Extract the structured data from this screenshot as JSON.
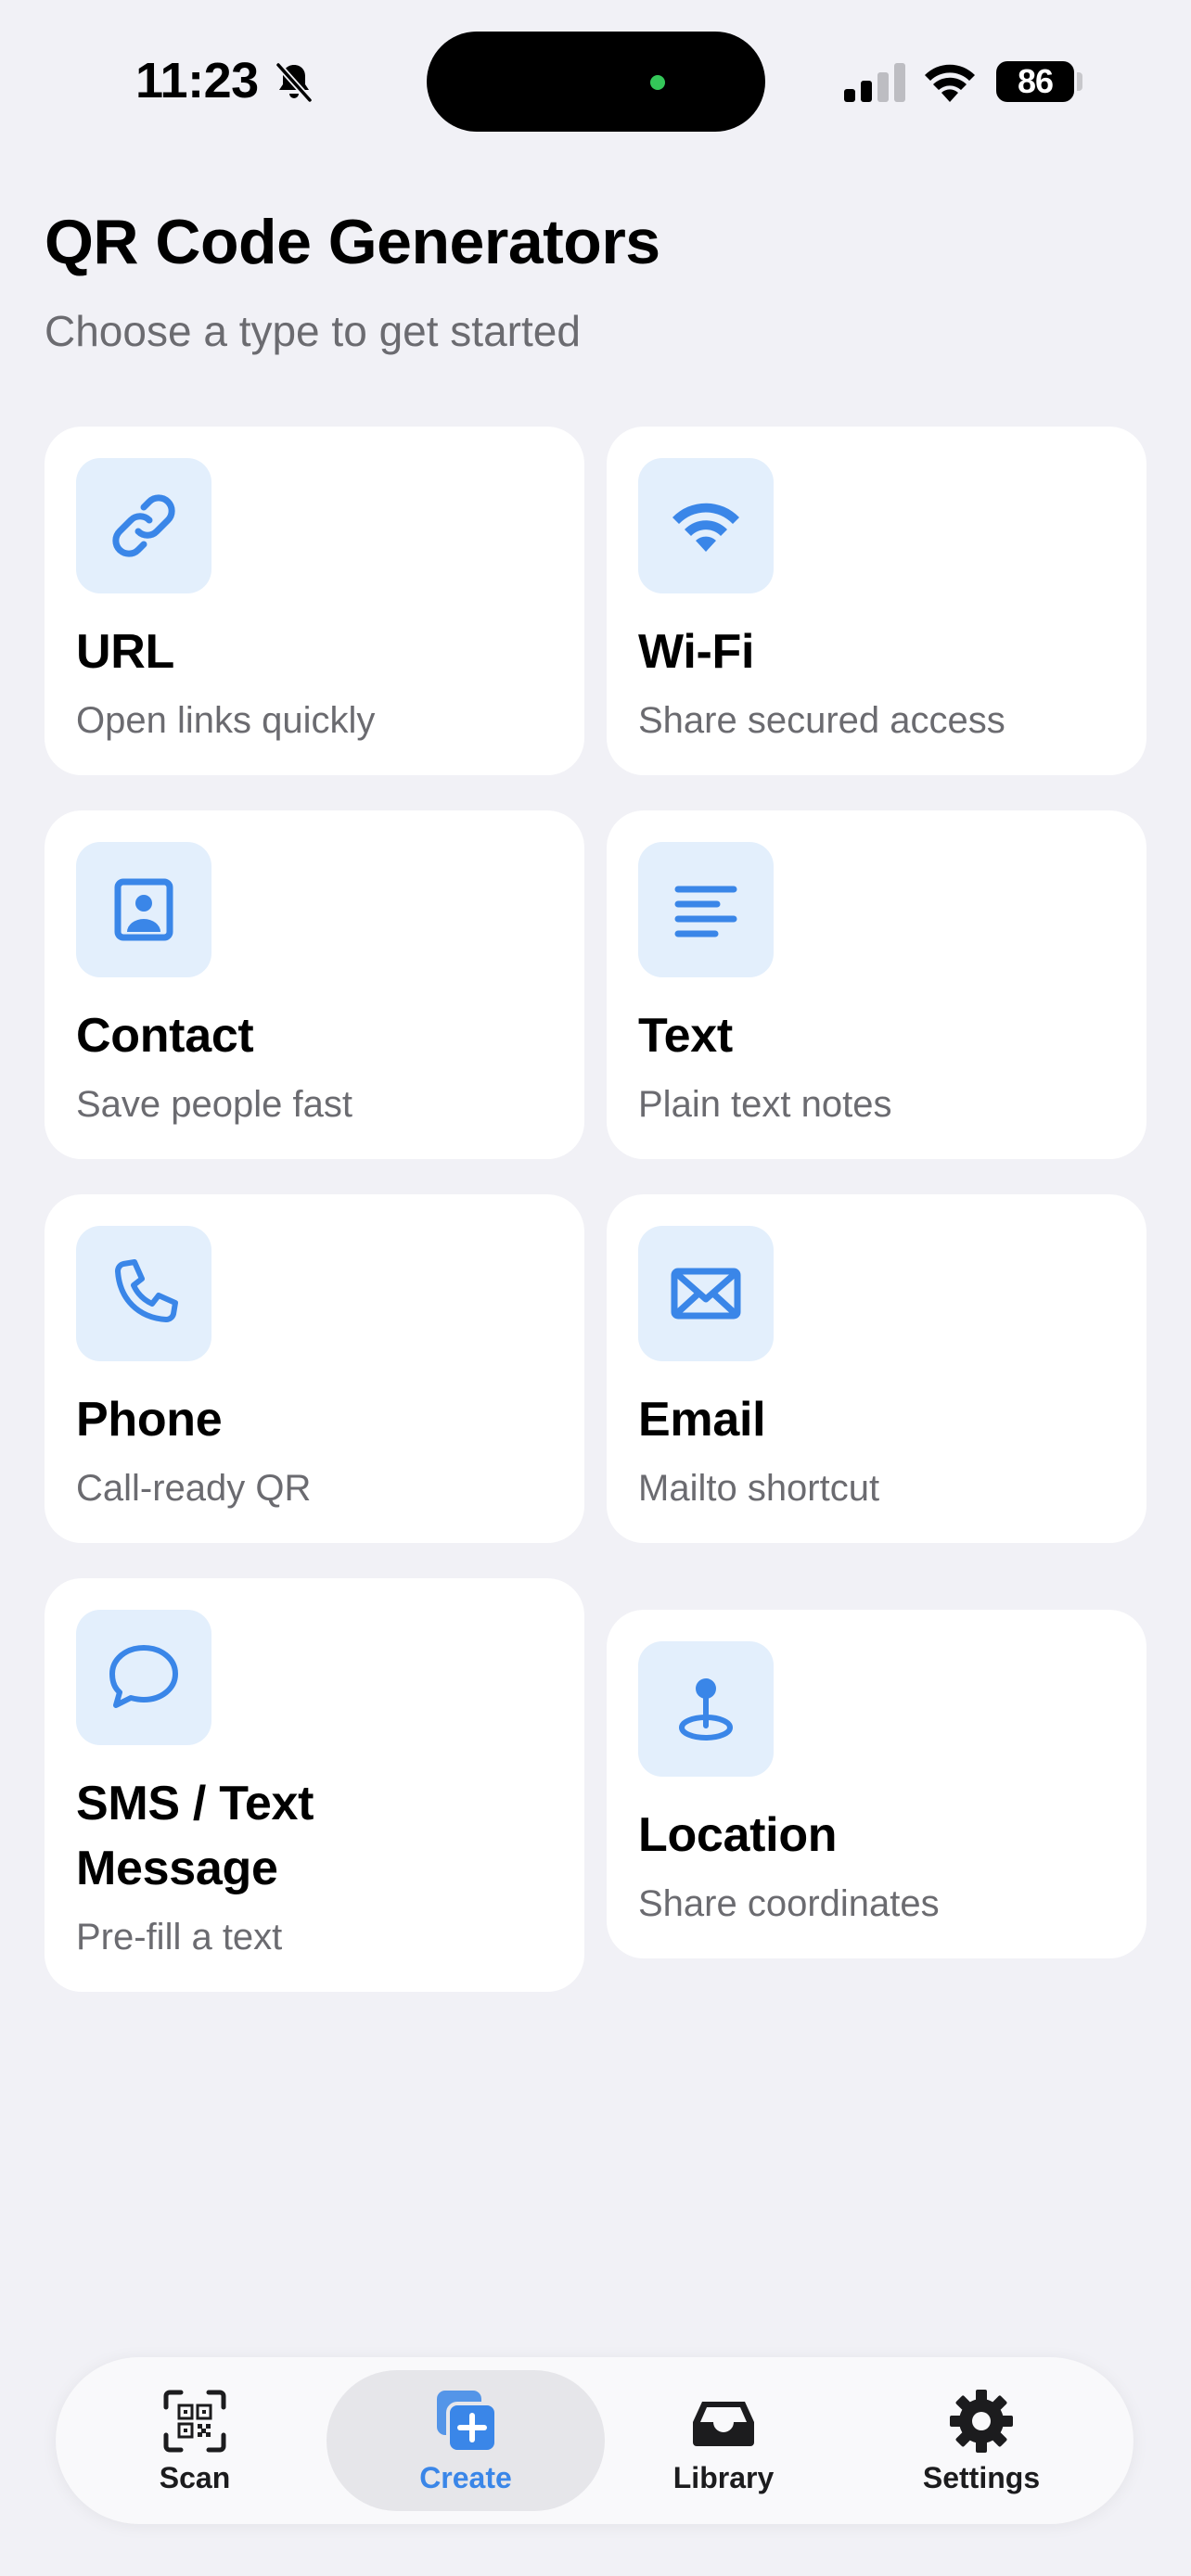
{
  "status_bar": {
    "time": "11:23",
    "battery_level": "86",
    "icons": [
      "bell-slash-icon",
      "signal-icon",
      "wifi-icon",
      "battery-icon"
    ]
  },
  "header": {
    "title": "QR Code Generators",
    "subtitle": "Choose a type to get started"
  },
  "generators": [
    {
      "icon": "link-icon",
      "title": "URL",
      "subtitle": "Open links quickly"
    },
    {
      "icon": "wifi-icon",
      "title": "Wi-Fi",
      "subtitle": "Share secured access"
    },
    {
      "icon": "contact-icon",
      "title": "Contact",
      "subtitle": "Save people fast"
    },
    {
      "icon": "text-lines-icon",
      "title": "Text",
      "subtitle": "Plain text notes"
    },
    {
      "icon": "phone-icon",
      "title": "Phone",
      "subtitle": "Call-ready QR"
    },
    {
      "icon": "envelope-icon",
      "title": "Email",
      "subtitle": "Mailto shortcut"
    },
    {
      "icon": "message-bubble-icon",
      "title_line1": "SMS / Text",
      "title_line2": "Message",
      "subtitle": "Pre-fill a text"
    },
    {
      "icon": "location-pin-icon",
      "title": "Location",
      "subtitle": "Share coordinates"
    }
  ],
  "tab_bar": {
    "tabs": [
      {
        "icon": "qr-scan-icon",
        "label": "Scan"
      },
      {
        "icon": "create-plus-icon",
        "label": "Create",
        "active": true
      },
      {
        "icon": "inbox-tray-icon",
        "label": "Library"
      },
      {
        "icon": "gear-icon",
        "label": "Settings"
      }
    ]
  },
  "colors": {
    "accent": "#3A86E8",
    "icon_tile": "#E3EFFC",
    "background": "#F1F1F6",
    "card": "#FFFFFF",
    "secondary_text": "#6B6B70"
  }
}
